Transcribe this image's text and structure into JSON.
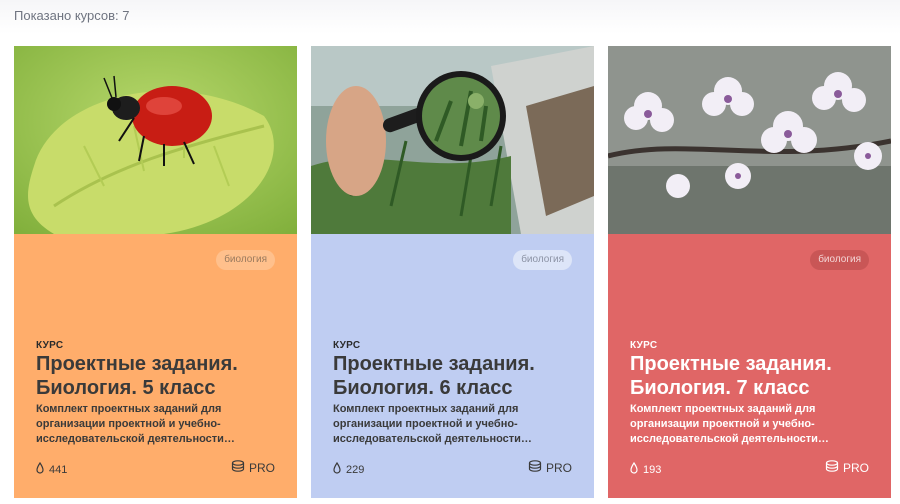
{
  "results": {
    "count_text": "Показано курсов: 7"
  },
  "cards": [
    {
      "tag": "биология",
      "type": "КУРС",
      "title": "Проектные задания. Биология. 5 класс",
      "description": "Комплект проектных заданий для организации проектной и учебно-исследовательской деятельности…",
      "views": "441",
      "badge": "PRO",
      "color": "#ffad6b",
      "image": "ladybug-on-leaf"
    },
    {
      "tag": "биология",
      "type": "КУРС",
      "title": "Проектные задания. Биология. 6 класс",
      "description": "Комплект проектных заданий для организации проектной и учебно-исследовательской деятельности…",
      "views": "229",
      "badge": "PRO",
      "color": "#bfcdf2",
      "image": "magnifying-glass-plants"
    },
    {
      "tag": "биология",
      "type": "КУРС",
      "title": "Проектные задания. Биология. 7 класс",
      "description": "Комплект проектных заданий для организации проектной и учебно-исследовательской деятельности…",
      "views": "193",
      "badge": "PRO",
      "color": "#e06666",
      "image": "cherry-blossoms"
    }
  ]
}
